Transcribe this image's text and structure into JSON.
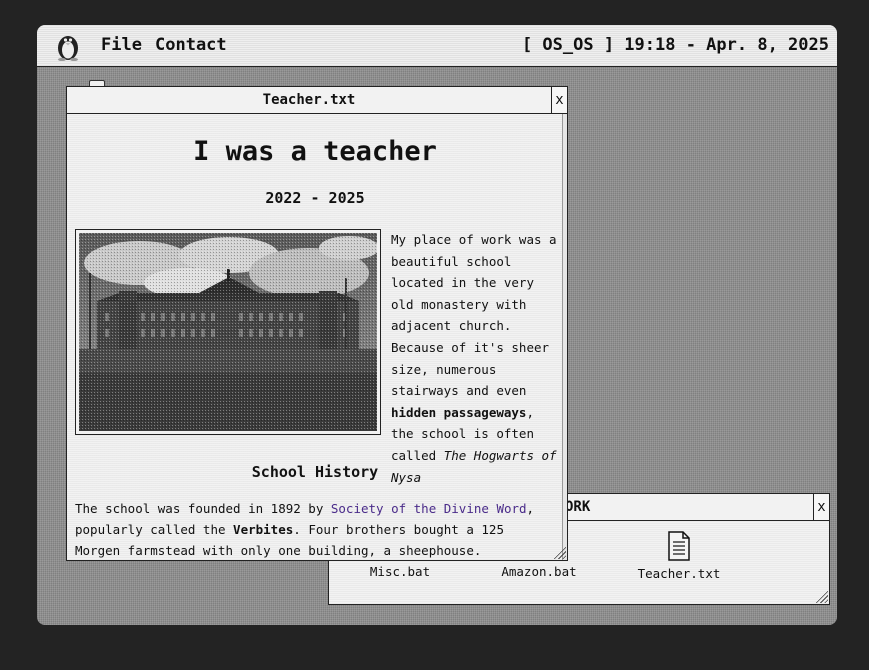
{
  "menubar": {
    "menu_file": "File",
    "menu_contact": "Contact",
    "clock": "[ OS_OS ]  19:18 - Apr. 8, 2025"
  },
  "work_window": {
    "title": "ORK",
    "close": "x",
    "files": [
      {
        "name": "Misc.bat",
        "icon": "terminal-icon"
      },
      {
        "name": "Amazon.bat",
        "icon": "terminal-icon"
      },
      {
        "name": "Teacher.txt",
        "icon": "document-icon"
      }
    ]
  },
  "teacher_window": {
    "title": "Teacher.txt",
    "close": "x",
    "heading": "I was a teacher",
    "years": "2022 - 2025",
    "para": {
      "text1": "My place of work was a beautiful school located in the very old monastery with adjacent church. Because of it's sheer size, numerous stairways and even ",
      "bold": "hidden passageways",
      "text2": ", the school is often called ",
      "italic": "The Hogwarts of Nysa"
    },
    "subheading": "School History",
    "history": {
      "text1": "The school was founded in 1892 by ",
      "link": "Society of the Divine Word",
      "text2": ", popularly called the ",
      "bold": "Verbites",
      "text3": ". Four brothers bought a 125 Morgen farmstead with only one building, a sheephouse."
    }
  },
  "colors": {
    "desktop": "#8f8f8f",
    "window": "#f2f2f2",
    "link": "#4a2b8a",
    "border": "#222222"
  }
}
